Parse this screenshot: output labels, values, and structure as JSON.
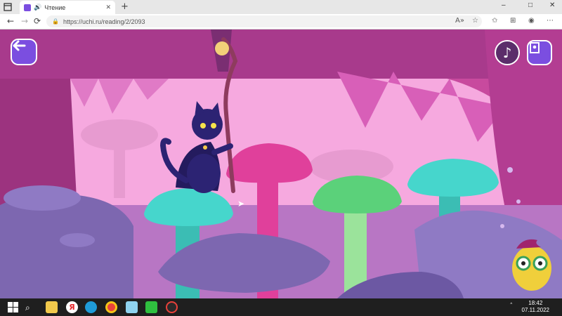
{
  "browser": {
    "tab": {
      "title": "Чтение",
      "audio_icon": "speaker-icon",
      "close_label": "✕"
    },
    "new_tab_label": "+",
    "window_controls": {
      "minimize": "–",
      "maximize": "□",
      "close": "✕"
    },
    "nav": {
      "back": "←",
      "forward": "→",
      "reload": "⟳"
    },
    "url": "https://uchi.ru/reading/2/2093",
    "toolbar_icons": [
      "read-aloud-icon",
      "favorites-star-icon",
      "collections-icon",
      "extensions-icon",
      "profile-icon",
      "more-icon"
    ]
  },
  "game": {
    "back_button_icon": "arrow-left-icon",
    "music_button_icon": "music-note-icon",
    "exit_button_icon": "exit-door-icon",
    "colors": {
      "sky": "#f6a9df",
      "cave_dark": "#c84a9e",
      "mushroom_teal": "#46d6cc",
      "mushroom_pink": "#e0409b",
      "mushroom_green": "#5bd17a",
      "rock_purple": "#7d67b0",
      "cat": "#2c2373",
      "button_purple": "#7b4ee0"
    }
  },
  "taskbar": {
    "apps": [
      "windows-start-icon",
      "search-icon",
      "file-explorer-icon",
      "yandex-browser-icon",
      "edge-icon",
      "chrome-icon",
      "notepad-icon",
      "video-app-icon",
      "record-app-icon"
    ],
    "chevron": "˄",
    "time": "18:42",
    "date": "07.11.2022"
  }
}
